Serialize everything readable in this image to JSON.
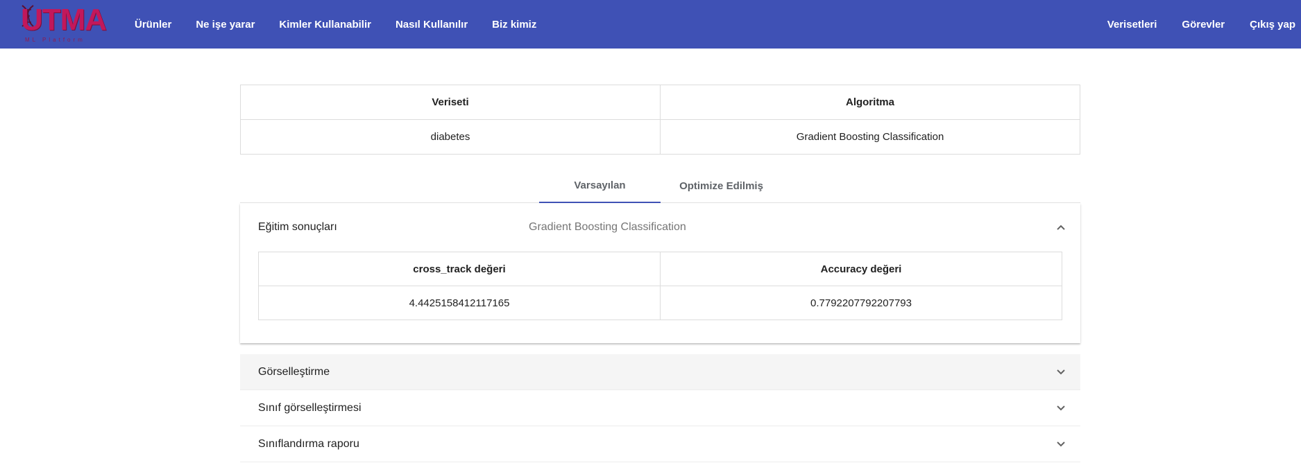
{
  "brand": {
    "logo_text": "UTMA",
    "logo_subtext": "ML Platform",
    "brand_color": "#c2185b",
    "navbar_color": "#3f51b5"
  },
  "nav": {
    "left": [
      "Ürünler",
      "Ne işe yarar",
      "Kimler Kullanabilir",
      "Nasıl Kullanılır",
      "Biz kimiz"
    ],
    "right": [
      "Verisetleri",
      "Görevler",
      "Çıkış yap"
    ]
  },
  "info_table": {
    "headers": [
      "Veriseti",
      "Algoritma"
    ],
    "row": [
      "diabetes",
      "Gradient Boosting Classification"
    ]
  },
  "tabs": {
    "items": [
      "Varsayılan",
      "Optimize Edilmiş"
    ],
    "active": "Varsayılan"
  },
  "training_panel": {
    "title": "Eğitim sonuçları",
    "subtitle": "Gradient Boosting Classification",
    "expanded": true,
    "table": {
      "headers": [
        "cross_track değeri",
        "Accuracy değeri"
      ],
      "row": [
        "4.4425158412117165",
        "0.7792207792207793"
      ]
    }
  },
  "collapsed_panels": [
    {
      "title": "Görselleştirme"
    },
    {
      "title": "Sınıf görselleştirmesi"
    },
    {
      "title": "Sınıflandırma raporu"
    }
  ]
}
